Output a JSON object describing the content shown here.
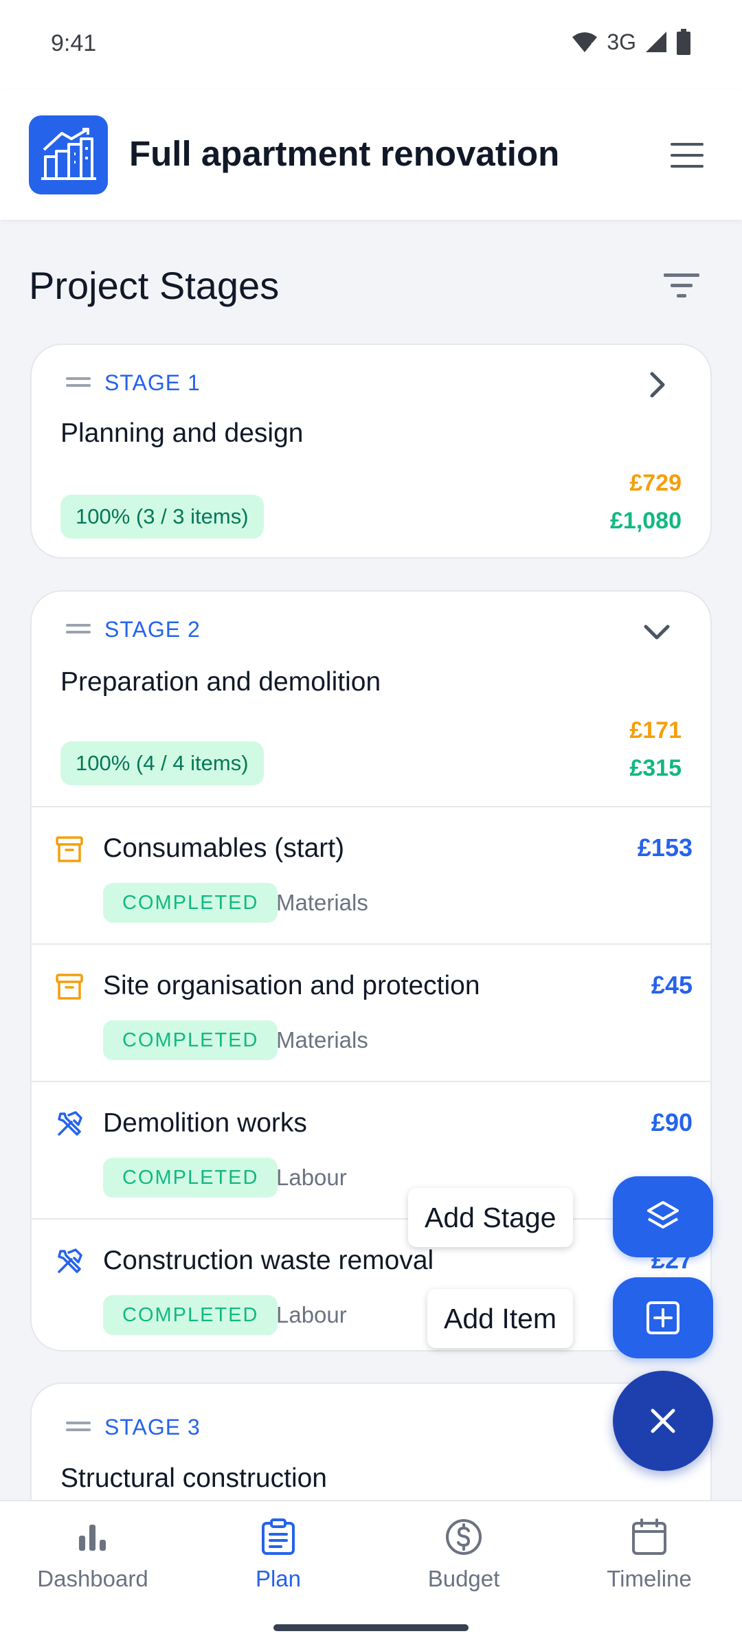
{
  "status_bar": {
    "time": "9:41",
    "network": "3G"
  },
  "app_bar": {
    "title": "Full apartment renovation",
    "logo_icon": "building-growth-icon",
    "menu_icon": "hamburger-menu-icon"
  },
  "section": {
    "title": "Project Stages",
    "filter_icon": "filter-icon"
  },
  "stages": [
    {
      "label": "STAGE 1",
      "name": "Planning and design",
      "progress": "100% (3 / 3 items)",
      "spent": "£729",
      "budget": "£1,080",
      "expanded": false
    },
    {
      "label": "STAGE 2",
      "name": "Preparation and demolition",
      "progress": "100% (4 / 4 items)",
      "spent": "£171",
      "budget": "£315",
      "expanded": true,
      "items": [
        {
          "name": "Consumables (start)",
          "amount": "£153",
          "status": "COMPLETED",
          "type": "Materials",
          "icon": "archive-box-icon"
        },
        {
          "name": "Site organisation and protection",
          "amount": "£45",
          "status": "COMPLETED",
          "type": "Materials",
          "icon": "archive-box-icon"
        },
        {
          "name": "Demolition works",
          "amount": "£90",
          "status": "COMPLETED",
          "type": "Labour",
          "icon": "hammer-wrench-icon"
        },
        {
          "name": "Construction waste removal",
          "amount": "£27",
          "status": "COMPLETED",
          "type": "Labour",
          "icon": "hammer-wrench-icon"
        }
      ]
    },
    {
      "label": "STAGE 3",
      "name": "Structural construction"
    }
  ],
  "fab_menu": {
    "add_stage": "Add Stage",
    "add_item": "Add Item"
  },
  "bottom_nav": [
    {
      "label": "Dashboard",
      "icon": "bar-chart-icon",
      "active": false
    },
    {
      "label": "Plan",
      "icon": "clipboard-list-icon",
      "active": true
    },
    {
      "label": "Budget",
      "icon": "dollar-circle-icon",
      "active": false
    },
    {
      "label": "Timeline",
      "icon": "calendar-icon",
      "active": false
    }
  ],
  "colors": {
    "primary": "#2563eb",
    "primary_dark": "#1e40af",
    "spent": "#f59e0b",
    "budget": "#10b981",
    "completed_bg": "#d1fae5"
  }
}
